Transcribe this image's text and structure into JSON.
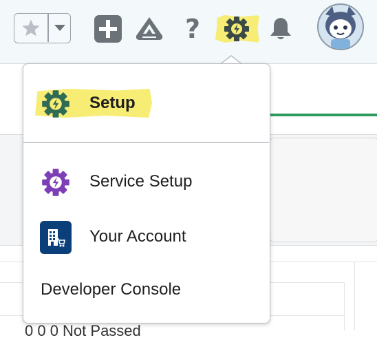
{
  "header": {
    "icons": {
      "favorite": "star-icon",
      "favorites_menu": "chevron-down-icon",
      "global_actions": "plus-icon",
      "guidance_center": "trailhead-icon",
      "help": "help-icon",
      "setup": "gear-bolt-icon",
      "notifications": "bell-icon",
      "avatar": "user-avatar"
    },
    "help_glyph": "?"
  },
  "setup_menu": {
    "items": [
      {
        "label": "Setup",
        "icon": "gear-bolt-icon",
        "highlighted": true,
        "icon_color": "#2f6b55"
      },
      {
        "label": "Service Setup",
        "icon": "gear-bolt-icon",
        "icon_color": "#7e3fb6"
      },
      {
        "label": "Your Account",
        "icon": "building-icon",
        "icon_color": "#0b3f7a"
      },
      {
        "label": "Developer Console"
      }
    ]
  },
  "background": {
    "bottom_text": "0 0 0 Not Passed"
  },
  "colors": {
    "highlight": "#f7ec74",
    "header_bg": "#f3f8fb",
    "icon_gray": "#6b7379",
    "accent_green": "#2e9b5e"
  }
}
